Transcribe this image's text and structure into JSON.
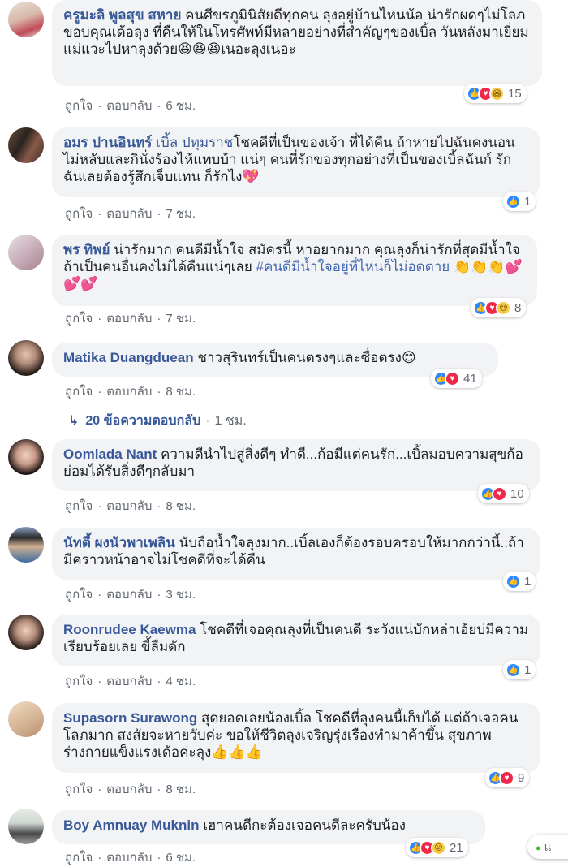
{
  "labels": {
    "like": "ถูกใจ",
    "reply": "ตอบกลับ",
    "dot": "·"
  },
  "comments": [
    {
      "author": "ครูมะลิ พูลสุข สหาย",
      "text": " คนศีขรภูมินิสัยดีทุกคน ลุงอยู่บ้านไหนน้อ น่ารักผดๆไม่โลภ ขอบคุณเด้อลุง ที่คืนให้ในโทรศัพท์มีหลายอย่างที่สำคัญๆของเบิ้ล วันหลังมาเยี่ยมแม่แวะไปหาลุงด้วย😆😆😆เนอะลุงเนอะ",
      "time": "6 ชม.",
      "reaction_count": "15",
      "reactions": [
        "like",
        "love",
        "haha"
      ]
    },
    {
      "author": "อมร ปานอินทร์",
      "tag": "เบิ้ล ปทุมราช",
      "text": "โชคดีที่เป็นของเจ้า ที่ได้คืน ถ้าหายไปฉันคงนอนไม่หลับและกินั่งร้องไห้แทบบ้า แน่ๆ คนที่รักของทุกอย่างที่เป็นของเบิ้ลฉันก์ รัก ฉันเลยต้องรู้สึกเจ็บแทน ก็รักไง💖",
      "time": "7 ชม.",
      "reaction_count": "1",
      "reactions": [
        "like"
      ]
    },
    {
      "author": "พร ทิพย์",
      "text": " น่ารักมาก คนดีมีน้ำใจ สมัครนี้ หาอยากมาก คุณลุงก็น่ารักที่สุดมีน้ำใจ ถ้าเป็นคนอื่นคงไม่ได้คืนแน่ๆเลย",
      "hashtag": "#คนดีมีน้ำใจอยู่ที่ไหนก็ไม่อดตาย",
      "emoji": "👏👏👏",
      "hearts": "💕💕💕",
      "time": "7 ชม.",
      "reaction_count": "8",
      "reactions": [
        "like",
        "love",
        "sad"
      ]
    },
    {
      "author": "Matika Duangduean",
      "text": " ชาวสุรินทร์เป็นคนตรงๆและซื่อตรง😊",
      "time": "8 ชม.",
      "reaction_count": "41",
      "reactions": [
        "like",
        "love"
      ]
    },
    {
      "author": "Oomlada Nant",
      "text": " ความดีนำไปสู่สิ่งดีๆ ทำดี...ก้อมีแต่คนรัก...เบิ้ลมอบความสุขก้อย่อมได้รับสิ่งดีๆกลับมา",
      "time": "8 ชม.",
      "reaction_count": "10",
      "reactions": [
        "like",
        "love"
      ]
    },
    {
      "author": "นัทตี้ ผงนัวพาเพลิน",
      "text": " นับถือน้ำใจลุงมาก..เบิ้ลเองก็ต้องรอบครอบให้มากกว่านี้..ถ้ามีคราวหน้าอาจไม่โชคดีที่จะได้คืน",
      "time": "3 ชม.",
      "reaction_count": "1",
      "reactions": [
        "like"
      ]
    },
    {
      "author": "Roonrudee Kaewma",
      "text": " โชคดีที่เจอคุณลุงที่เป็นคนดี ระวังแน่บักหล่าเอ้ยบ่มีความเรียบร้อยเลย ขี้ลืมดัก",
      "time": "4 ชม.",
      "reaction_count": "1",
      "reactions": [
        "like"
      ]
    },
    {
      "author": "Supasorn Surawong",
      "text": " สุดยอดเลยน้องเบิ้ล โชคดีที่ลุงคนนี้เก็บได้ แต่ถ้าเจอคนโลภมาก สงสัยจะหายวับค่ะ ขอให้ชีวิตลุงเจริญรุ่งเรืองทำมาค้าขึ้น สุขภาพร่างกายแข็งแรงเด้อค่ะลุง👍👍👍",
      "time": "8 ชม.",
      "reaction_count": "9",
      "reactions": [
        "like",
        "love"
      ]
    },
    {
      "author": "Boy Amnuay Muknin",
      "text": " เฮาคนดีกะต้องเจอคนดีละครับน้อง",
      "time": "6 ชม.",
      "reaction_count": "21",
      "reactions": [
        "like",
        "love",
        "wow"
      ]
    }
  ],
  "replies_link": {
    "label": "20 ข้อความตอบกลับ",
    "time": "1 ชม."
  },
  "chat": {
    "label": "แ"
  },
  "colors": {
    "author": "#385898",
    "bubble": "#f2f3f5",
    "like": "#2d88ff",
    "love": "#f0284a"
  }
}
